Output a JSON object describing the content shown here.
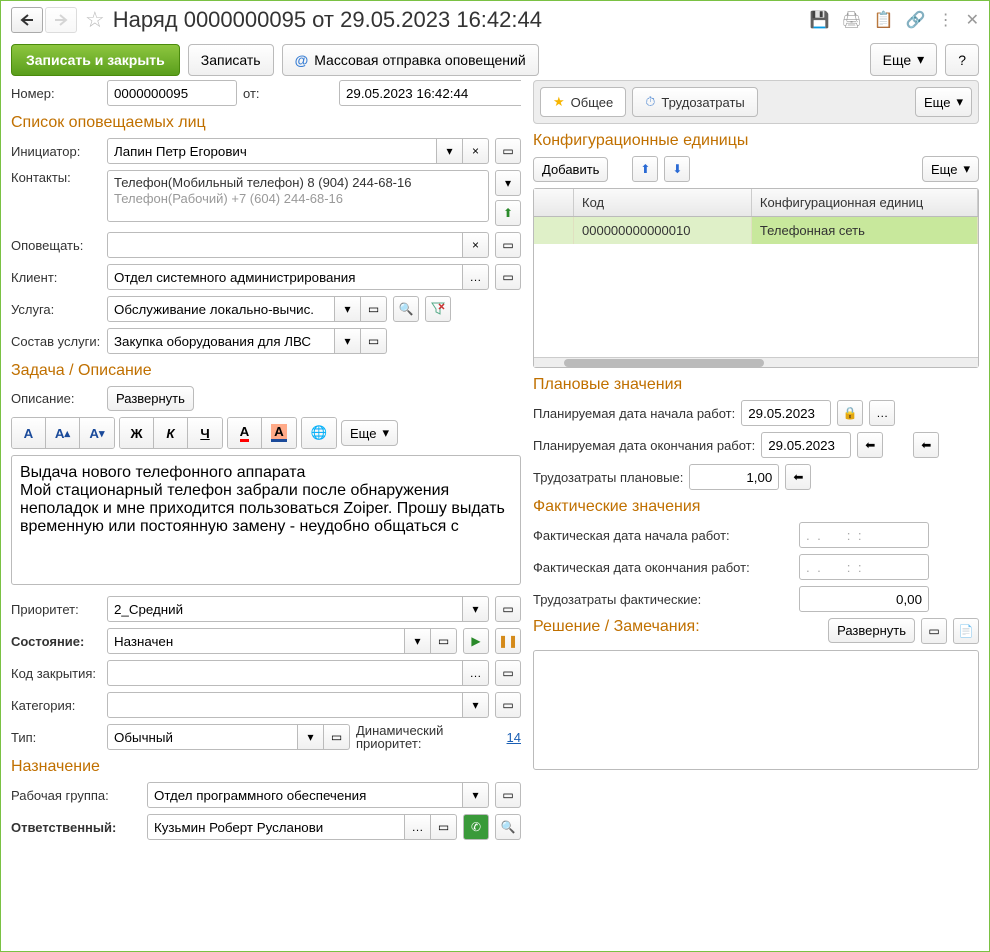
{
  "title": "Наряд 0000000095 от 29.05.2023 16:42:44",
  "toolbar": {
    "save_close": "Записать и закрыть",
    "save": "Записать",
    "mass_send": "Массовая отправка оповещений",
    "more": "Еще",
    "help": "?"
  },
  "fields": {
    "number_label": "Номер:",
    "number": "0000000095",
    "from_label": "от:",
    "from": "29.05.2023 16:42:44",
    "initiator_label": "Инициатор:",
    "initiator": "Лапин Петр Егорович",
    "contacts_label": "Контакты:",
    "contact1": "Телефон(Мобильный телефон)   8 (904) 244-68-16",
    "contact2": "Телефон(Рабочий)   +7 (604) 244-68-16",
    "notify_label": "Оповещать:",
    "client_label": "Клиент:",
    "client": "Отдел системного администрирования",
    "service_label": "Услуга:",
    "service": "Обслуживание локально-вычис.",
    "service_comp_label": "Состав услуги:",
    "service_comp": "Закупка оборудования для ЛВС",
    "desc_label": "Описание:",
    "expand": "Развернуть",
    "priority_label": "Приоритет:",
    "priority": "2_Средний",
    "state_label": "Состояние:",
    "state": "Назначен",
    "close_code_label": "Код закрытия:",
    "category_label": "Категория:",
    "type_label": "Тип:",
    "type": "Обычный",
    "dyn_priority_label": "Динамический приоритет:",
    "dyn_priority": "14",
    "workgroup_label": "Рабочая группа:",
    "workgroup": "Отдел программного обеспечения",
    "responsible_label": "Ответственный:",
    "responsible": "Кузьмин Роберт Русланови"
  },
  "sections": {
    "notified": "Список оповещаемых лиц",
    "task": "Задача / Описание",
    "assignment": "Назначение",
    "config": "Конфигурационные единицы",
    "planned": "Плановые значения",
    "actual": "Фактические значения",
    "solution": "Решение / Замечания:"
  },
  "description_text": "Выдача нового телефонного аппарата\nМой стационарный телефон забрали после обнаружения неполадок и мне приходится пользоваться Zoiper. Прошу выдать временную или постоянную замену - неудобно общаться с",
  "tabs": {
    "general": "Общее",
    "labor": "Трудозатраты",
    "more": "Еще"
  },
  "config_table": {
    "add": "Добавить",
    "more": "Еще",
    "col_code": "Код",
    "col_unit": "Конфигурационная единиц",
    "row_code": "000000000000010",
    "row_unit": "Телефонная сеть"
  },
  "planned": {
    "start_label": "Планируемая дата начала работ:",
    "start": "29.05.2023",
    "end_label": "Планируемая дата окончания работ:",
    "end": "29.05.2023",
    "labor_label": "Трудозатраты плановые:",
    "labor": "1,00"
  },
  "actual": {
    "start_label": "Фактическая дата начала работ:",
    "start": ".  .       :  :",
    "end_label": "Фактическая дата окончания работ:",
    "end": ".  .       :  :",
    "labor_label": "Трудозатраты фактические:",
    "labor": "0,00"
  },
  "solution": {
    "expand": "Развернуть"
  },
  "rt": {
    "more": "Еще"
  }
}
